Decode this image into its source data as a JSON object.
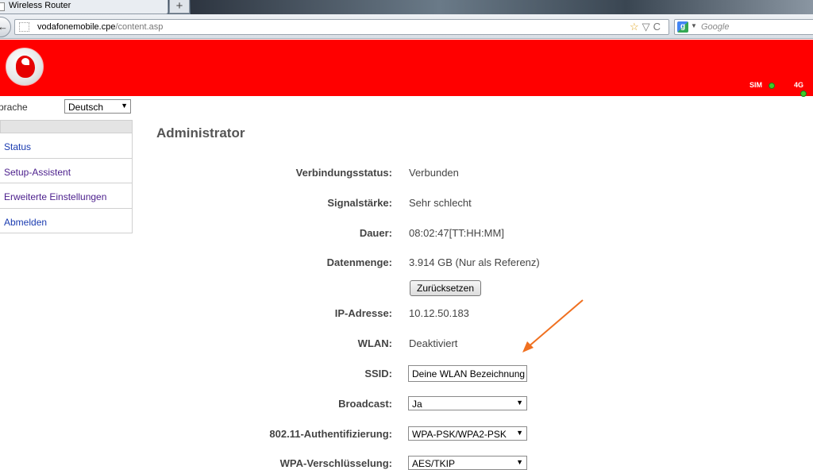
{
  "browser": {
    "tab_title": "Wireless Router",
    "new_tab": "+",
    "url_host": "vodafonemobile.cpe",
    "url_path": "/content.asp",
    "search_placeholder": "Google",
    "url_buttons": "☆ ▽ C"
  },
  "header": {
    "indicators": [
      {
        "label": "SIM",
        "status_color": "#3dcc2a"
      },
      {
        "label": "4G",
        "status_color": "#3dcc2a"
      }
    ]
  },
  "sidebar": {
    "language_label": "prache",
    "language_value": "Deutsch",
    "items": [
      {
        "label": "Status"
      },
      {
        "label": "Setup-Assistent"
      },
      {
        "label": "Erweiterte Einstellungen"
      },
      {
        "label": "Abmelden"
      }
    ]
  },
  "main": {
    "title": "Administrator",
    "rows": {
      "connection": {
        "label": "Verbindungsstatus:",
        "value": "Verbunden"
      },
      "signal": {
        "label": "Signalstärke:",
        "value": "Sehr schlecht"
      },
      "duration": {
        "label": "Dauer:",
        "value": "08:02:47[TT:HH:MM]"
      },
      "data": {
        "label": "Datenmenge:",
        "value": "3.914 GB (Nur als Referenz)"
      },
      "reset_button": "Zurücksetzen",
      "ip": {
        "label": "IP-Adresse:",
        "value": "10.12.50.183"
      },
      "wlan": {
        "label": "WLAN:",
        "value": "Deaktiviert"
      },
      "ssid": {
        "label": "SSID:",
        "value": "Deine WLAN Bezeichnung"
      },
      "broadcast": {
        "label": "Broadcast:",
        "value": "Ja"
      },
      "auth": {
        "label": "802.11-Authentifizierung:",
        "value": "WPA-PSK/WPA2-PSK"
      },
      "encryption": {
        "label": "WPA-Verschlüsselung:",
        "value": "AES/TKIP"
      }
    }
  },
  "colors": {
    "brand_red": "#ff0000",
    "annotation_arrow": "#f07020"
  }
}
